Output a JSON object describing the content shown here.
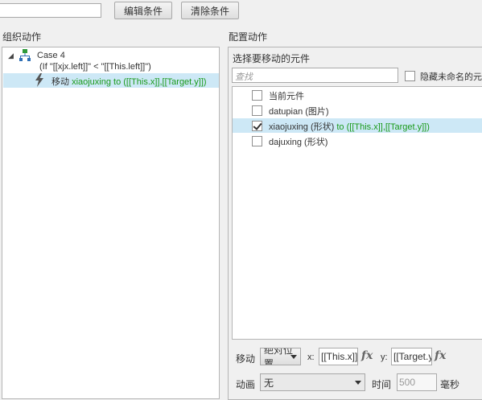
{
  "toolbar": {
    "edit_condition": "编辑条件",
    "clear_condition": "清除条件"
  },
  "left_panel": {
    "title": "组织动作",
    "case": {
      "name": "Case 4",
      "condition": "(If \"[[xjx.left]]\" < \"[[This.left]]\")",
      "action": {
        "verb": "移动",
        "target": "xiaojuxing to ([[This.x]],[[Target.y]])"
      }
    }
  },
  "right_panel": {
    "title": "配置动作",
    "choose_label": "选择要移动的元件",
    "search_placeholder": "查找",
    "hide_unnamed_label": "隐藏未命名的元件",
    "elements": [
      {
        "label": "当前元件",
        "extra": "",
        "checked": false,
        "selected": false
      },
      {
        "label": "datupian (图片)",
        "extra": "",
        "checked": false,
        "selected": false
      },
      {
        "label": "xiaojuxing (形状)",
        "extra": " to ([[This.x]],[[Target.y]])",
        "checked": true,
        "selected": true
      },
      {
        "label": "dajuxing (形状)",
        "extra": "",
        "checked": false,
        "selected": false
      }
    ],
    "move": {
      "label": "移动",
      "mode": "绝对位置",
      "x_label": "x:",
      "x_value": "[[This.x]]",
      "y_label": "y:",
      "y_value": "[[Target.y]]",
      "fx_label": "fx"
    },
    "animation": {
      "label": "动画",
      "value": "无",
      "time_label": "时间",
      "time_value": "500",
      "unit_label": "毫秒"
    }
  },
  "colors": {
    "selection": "#cde8f6",
    "green_text": "#1a9a1a"
  }
}
